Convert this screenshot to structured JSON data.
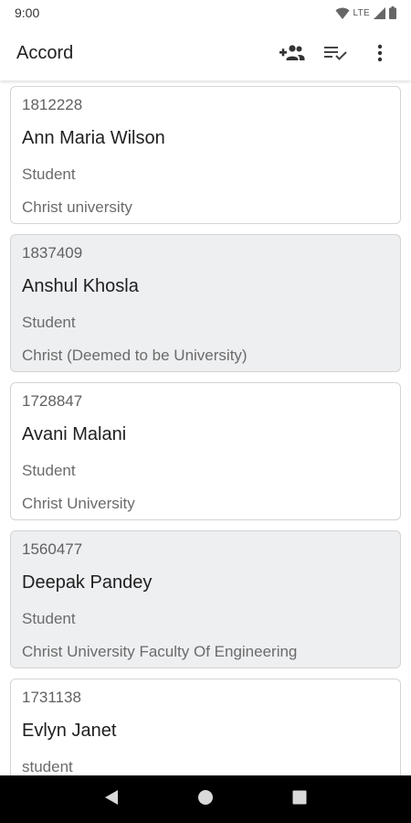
{
  "status_bar": {
    "time": "9:00",
    "network": "LTE"
  },
  "app_bar": {
    "title": "Accord",
    "actions": [
      {
        "icon": "add-group-icon"
      },
      {
        "icon": "playlist-check-icon"
      },
      {
        "icon": "more-vert-icon"
      }
    ]
  },
  "list": {
    "items": [
      {
        "id": "1812228",
        "name": "Ann Maria Wilson",
        "role": "Student",
        "org": "Christ university",
        "shaded": false
      },
      {
        "id": "1837409",
        "name": "Anshul Khosla",
        "role": "Student",
        "org": "Christ (Deemed to be University)",
        "shaded": true
      },
      {
        "id": "1728847",
        "name": "Avani Malani",
        "role": "Student",
        "org": "Christ University",
        "shaded": false
      },
      {
        "id": "1560477",
        "name": "Deepak Pandey",
        "role": "Student",
        "org": "Christ University Faculty Of Engineering",
        "shaded": true
      },
      {
        "id": "1731138",
        "name": "Evlyn Janet",
        "role": "student",
        "org": "",
        "shaded": false
      }
    ]
  },
  "colors": {
    "card_shaded": "#eeeff1",
    "card_border": "#d4d4d4",
    "nav_bar": "#000000"
  }
}
